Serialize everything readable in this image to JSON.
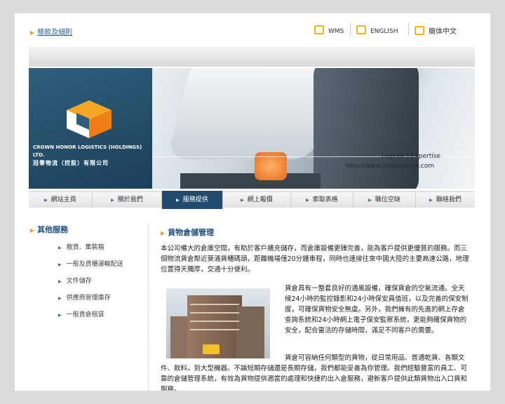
{
  "header": {
    "terms_link": "條款及細則",
    "languages": [
      "WMS",
      "ENGLISH",
      "簡体中文"
    ]
  },
  "banner": {
    "company_name_en": "CROWN HONOR LOGISTICS (HOLDINGS) LTD.",
    "company_name_zh": "冠譽物流（控股）有限公司",
    "tagline": "Logistics Expertise",
    "url": "http://www.crownhonor.com"
  },
  "nav": {
    "items": [
      "網站主頁",
      "關於我們",
      "服務提供",
      "網上報價",
      "索取表格",
      "職位空缺",
      "聯絡我們"
    ],
    "active_index": 2
  },
  "sidebar": {
    "title": "其他服務",
    "items": [
      "散貨、集裝箱",
      "一般及貨櫃運輸配送",
      "文件儲存",
      "供應商管理庫存",
      "一般貨倉租賃"
    ]
  },
  "main": {
    "title": "貨物倉儲管理",
    "intro": "本公司備大的倉庫空間，有助於客戶擴充儲存，而倉庫設備更臻完善，能為客戶提供更優質的服務。而三個物流貨倉鄰近葵涌貨櫃碼頭，距離機場僅20分鐘車程，同時也連接往來中國大陸的主要高速公路，地理位置得天獨厚，交通十分便利。",
    "para2": "貨倉具有一整套良好的通風設備，確保貨倉的空氣流通。全天候24小時的監控錄影和24小時保安員值班，以及完善的保安制度，可確保貨物安全無虞。另外，我們擁有的先進的網上存倉查詢系統和24小時網上電子保安監察系統，更能夠確保貨物的安全，配合靈活的存儲時間，滿足不同客戶的需要。",
    "para3": "貨倉可容納任何類型的貨物，從日常用品、普通乾貨、各類文件、飲料，到大型機器。不論短期存儲還是長期存儲，我們都能妥善為你管理。我們經驗豐富的員工、可靠的倉儲管理系統，有效為貨物提供適當的處理和快捷的出入倉服務，避新客戶提供此類貨物出入口貨和服務。"
  },
  "colors": {
    "brand_blue": "#214c6e",
    "accent_orange": "#f0a020",
    "link_blue": "#2a5f9e"
  }
}
